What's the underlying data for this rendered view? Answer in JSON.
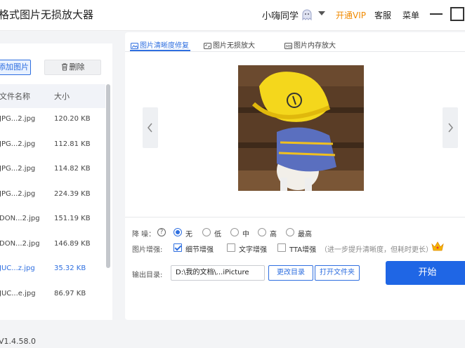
{
  "app": {
    "title": "格式图片无损放大器"
  },
  "header": {
    "user_name": "小嗨同学",
    "vip_label": "开通VIP",
    "service_label": "客服",
    "menu_label": "菜单",
    "avatar_icon": "ghost-avatar-icon",
    "accent_color": "#2f6fe0",
    "vip_color": "#f08a00"
  },
  "left": {
    "add_label": "添加图片",
    "delete_label": "删除",
    "columns": {
      "name": "文件名称",
      "size": "大小"
    },
    "files": [
      {
        "name": "JPG...2.jpg",
        "size": "120.20 KB",
        "selected": false
      },
      {
        "name": "JPG...2.jpg",
        "size": "112.81 KB",
        "selected": false
      },
      {
        "name": "JPG...2.jpg",
        "size": "114.82 KB",
        "selected": false
      },
      {
        "name": "JPG...2.jpg",
        "size": "224.39 KB",
        "selected": false
      },
      {
        "name": "DON...2.jpg",
        "size": "151.19 KB",
        "selected": false
      },
      {
        "name": "DON...2.jpg",
        "size": "146.89 KB",
        "selected": false
      },
      {
        "name": "JUC...z.jpg",
        "size": "35.32 KB",
        "selected": true
      },
      {
        "name": "JUC...e.jpg",
        "size": "86.97 KB",
        "selected": false
      }
    ]
  },
  "tabs": [
    {
      "label": "图片清晰度修复",
      "icon": "image-repair-icon",
      "active": true
    },
    {
      "label": "图片无损放大",
      "icon": "image-enlarge-icon",
      "active": false
    },
    {
      "label": "图片内存放大",
      "icon": "memory-enlarge-icon",
      "active": false
    }
  ],
  "options": {
    "denoise_label": "降 噪：",
    "denoise_options": [
      "无",
      "低",
      "中",
      "高",
      "最高"
    ],
    "denoise_selected": "无",
    "enhance_label": "图片增强:",
    "enhance_options": [
      {
        "label": "细节增强",
        "checked": true
      },
      {
        "label": "文字增强",
        "checked": false
      },
      {
        "label": "TTA增强",
        "checked": false
      }
    ],
    "tta_hint": "（进一步提升清晰度，但耗时更长）",
    "output_label": "输出目录:",
    "output_path": "D:\\我的文档\\...iPicture",
    "change_dir_label": "更改目录",
    "open_folder_label": "打开文件夹",
    "start_label": "开始"
  },
  "status": {
    "version": "V1.4.58.0"
  }
}
